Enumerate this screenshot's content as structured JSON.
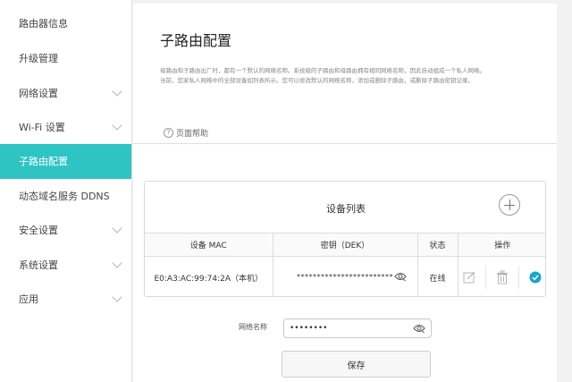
{
  "sidebar": {
    "items": [
      {
        "label": "路由器信息",
        "chevron": false,
        "active": false
      },
      {
        "label": "升级管理",
        "chevron": false,
        "active": false
      },
      {
        "label": "网络设置",
        "chevron": true,
        "active": false
      },
      {
        "label": "Wi-Fi 设置",
        "chevron": true,
        "active": false
      },
      {
        "label": "子路由配置",
        "chevron": false,
        "active": true
      },
      {
        "label": "动态域名服务 DDNS",
        "chevron": false,
        "active": false
      },
      {
        "label": "安全设置",
        "chevron": true,
        "active": false
      },
      {
        "label": "系统设置",
        "chevron": true,
        "active": false
      },
      {
        "label": "应用",
        "chevron": true,
        "active": false
      }
    ]
  },
  "main": {
    "title": "子路由配置",
    "description_line1": "母路由和子路由出厂时，都有一个默认的网络名称。系统级的子路由和母路由拥有相同网络名称，因此自动组成一个私人网络。",
    "description_line2": "当前，您家私人网络中的全部设备如列表所示。您可以修改默认的网络名称，添加或删除子路由，或删除子路由密钥记录。",
    "help_label": "页面帮助",
    "help_icon": "?"
  },
  "device_list": {
    "title": "设备列表",
    "columns": [
      "设备 MAC",
      "密钥（DEK）",
      "状态",
      "操作"
    ],
    "rows": [
      {
        "mac": "E0:A3:AC:99:74:2A（本机）",
        "key": "************************",
        "status": "在线"
      }
    ]
  },
  "form": {
    "network_name_label": "网络名称",
    "network_name_value": "••••••••",
    "save_label": "保存"
  },
  "colors": {
    "accent": "#2ec4c4",
    "check": "#19a6c7"
  }
}
